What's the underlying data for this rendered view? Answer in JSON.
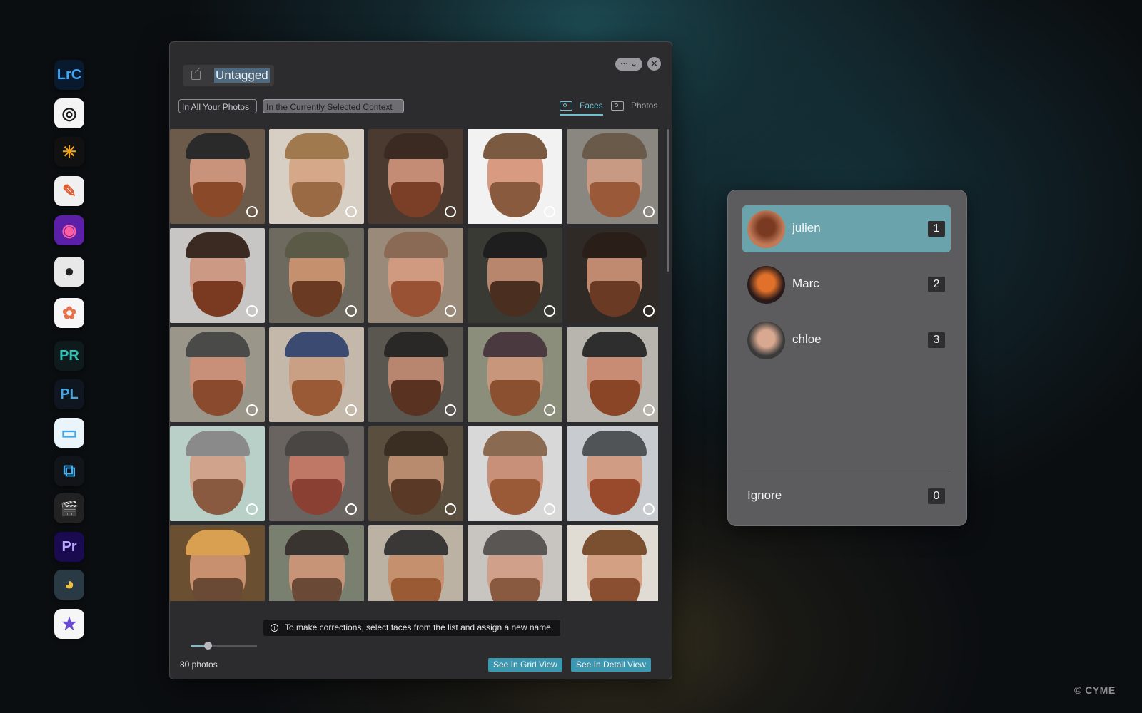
{
  "dock": [
    {
      "name": "lightroom-classic-icon",
      "label": "LrC",
      "bg": "#0a1a2e",
      "fg": "#3ea6f5"
    },
    {
      "name": "capture-one-icon",
      "label": "◎",
      "bg": "#f4f4f4",
      "fg": "#1a1a1a"
    },
    {
      "name": "luminar-icon",
      "label": "✳",
      "bg": "#111111",
      "fg": "#f0a41e"
    },
    {
      "name": "pixelmator-icon",
      "label": "✎",
      "bg": "#f0f0f0",
      "fg": "#e05a30"
    },
    {
      "name": "dxo-photolab-icon",
      "label": "◉",
      "bg": "#5b1fa8",
      "fg": "#ff5fa0"
    },
    {
      "name": "camera-app-icon",
      "label": "●",
      "bg": "#e8e8e8",
      "fg": "#222222"
    },
    {
      "name": "apple-photos-icon",
      "label": "✿",
      "bg": "#f6f6f6",
      "fg": "#e8704a"
    },
    {
      "name": "photo-raw-icon",
      "label": "PR",
      "bg": "#0f1a1d",
      "fg": "#2fc4b8"
    },
    {
      "name": "photolab-pl-icon",
      "label": "PL",
      "bg": "#0f1620",
      "fg": "#4aa6e0"
    },
    {
      "name": "finder-folder-icon",
      "label": "▭",
      "bg": "#eaf4fb",
      "fg": "#42a5e6"
    },
    {
      "name": "crop-tool-icon",
      "label": "⧉",
      "bg": "#111418",
      "fg": "#4ab0f0"
    },
    {
      "name": "final-cut-icon",
      "label": "🎬",
      "bg": "#222222",
      "fg": "#f0c040"
    },
    {
      "name": "premiere-pro-icon",
      "label": "Pr",
      "bg": "#1a0a50",
      "fg": "#b9a8ff"
    },
    {
      "name": "davinci-resolve-icon",
      "label": "◕",
      "bg": "#2a3a44",
      "fg": "#f0c040"
    },
    {
      "name": "imovie-icon",
      "label": "★",
      "bg": "#f6f6f6",
      "fg": "#6a4ad0"
    }
  ],
  "window": {
    "title": "Untagged",
    "menu_label": "··· ⌄",
    "close_label": "✕",
    "scope_all": "In All Your Photos",
    "scope_context": "In the Currently Selected Context",
    "view_faces": "Faces",
    "view_photos": "Photos",
    "tip": "To make corrections, select faces from the list and assign a new name.",
    "tip_icon": "i",
    "photo_count": "80 photos",
    "grid_view_btn": "See In Grid View",
    "detail_view_btn": "See In Detail View",
    "zoom_level": 0.25
  },
  "thumbnails": [
    {
      "bg": "#6c5a4a",
      "skin": "#c9927a",
      "beard": "#8a4a2a",
      "hat": "#2a2a2a"
    },
    {
      "bg": "#d8cfc4",
      "skin": "#d6a88a",
      "beard": "#9a6a44",
      "hat": "#a0794e"
    },
    {
      "bg": "#4a3a30",
      "skin": "#c48c74",
      "beard": "#7a3f26",
      "hat": "#3a2a22"
    },
    {
      "bg": "#f2f2f2",
      "skin": "#d89a80",
      "beard": "#8a5a3e",
      "hat": "#7a5a40"
    },
    {
      "bg": "#8a8680",
      "skin": "#c89a84",
      "beard": "#9a5a3a",
      "hat": "#6a5a4a"
    },
    {
      "bg": "#c8c6c4",
      "skin": "#cc9a84",
      "beard": "#7a3a22",
      "hat": "#3a2a22"
    },
    {
      "bg": "#6e6a60",
      "skin": "#c4906e",
      "beard": "#6a3a22",
      "hat": "#5a5a46"
    },
    {
      "bg": "#9a8a7a",
      "skin": "#d09a80",
      "beard": "#9a5234",
      "hat": "#8a6a54"
    },
    {
      "bg": "#3a3a34",
      "skin": "#b8866c",
      "beard": "#4a2e20",
      "hat": "#1e1e1e"
    },
    {
      "bg": "#302a26",
      "skin": "#c08a70",
      "beard": "#6a3a24",
      "hat": "#2a1e18"
    },
    {
      "bg": "#9a968a",
      "skin": "#c89078",
      "beard": "#8a4a2e",
      "hat": "#4a4a48"
    },
    {
      "bg": "#c4b8aa",
      "skin": "#caa084",
      "beard": "#9a5a36",
      "hat": "#3a4a70"
    },
    {
      "bg": "#5a5650",
      "skin": "#b8866e",
      "beard": "#5a3222",
      "hat": "#2a2826"
    },
    {
      "bg": "#8a8e7a",
      "skin": "#c8967a",
      "beard": "#8a5030",
      "hat": "#4a3a40"
    },
    {
      "bg": "#b8b4ae",
      "skin": "#c88c74",
      "beard": "#8a4426",
      "hat": "#2e2e2e"
    },
    {
      "bg": "#b8d0c8",
      "skin": "#d0a48c",
      "beard": "#8a5a40",
      "hat": "#8a8a8a"
    },
    {
      "bg": "#6a6460",
      "skin": "#c07866",
      "beard": "#8a4032",
      "hat": "#4a4644"
    },
    {
      "bg": "#5a4e3e",
      "skin": "#b88a6e",
      "beard": "#5a3a26",
      "hat": "#3a2e22"
    },
    {
      "bg": "#d8d8d8",
      "skin": "#c89078",
      "beard": "#9a5a38",
      "hat": "#8a6a50"
    },
    {
      "bg": "#c8ccd0",
      "skin": "#d09c84",
      "beard": "#9a4a2c",
      "hat": "#505456"
    },
    {
      "bg": "#6a5030",
      "skin": "#c8906e",
      "beard": "#6a4a34",
      "hat": "#d8a050"
    },
    {
      "bg": "#7a8070",
      "skin": "#c89478",
      "beard": "#6a4a36",
      "hat": "#3a3430"
    },
    {
      "bg": "#bcb2a4",
      "skin": "#c4906e",
      "beard": "#9a5a34",
      "hat": "#3a3836"
    },
    {
      "bg": "#c8c4c0",
      "skin": "#d0a08a",
      "beard": "#8a5a40",
      "hat": "#5a5654"
    },
    {
      "bg": "#e0dcd4",
      "skin": "#d4a084",
      "beard": "#8a4e30",
      "hat": "#7a5030"
    }
  ],
  "people": [
    {
      "name": "julien",
      "count": "1",
      "selected": true,
      "avatar_bg": "#c07a58",
      "avatar_fg": "#7a3a22"
    },
    {
      "name": "Marc",
      "count": "2",
      "selected": false,
      "avatar_bg": "#2a1a1a",
      "avatar_fg": "#e0702a"
    },
    {
      "name": "chloe",
      "count": "3",
      "selected": false,
      "avatar_bg": "#3a3a3a",
      "avatar_fg": "#d8a890"
    }
  ],
  "ignore": {
    "label": "Ignore",
    "count": "0"
  },
  "copyright": "© CYME",
  "colors": {
    "accent": "#6fc0d0",
    "button": "#3c98b0",
    "selected_row": "#6aa3ac"
  }
}
